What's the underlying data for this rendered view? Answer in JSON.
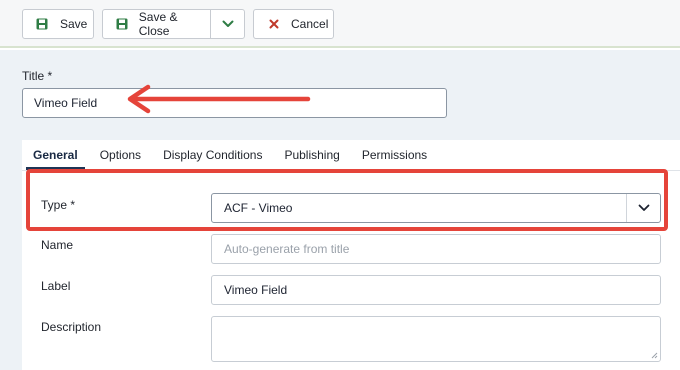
{
  "toolbar": {
    "save_label": "Save",
    "save_close_label": "Save & Close",
    "cancel_label": "Cancel"
  },
  "title_field": {
    "label": "Title *",
    "value": "Vimeo Field"
  },
  "tabs": [
    {
      "label": "General",
      "active": true
    },
    {
      "label": "Options",
      "active": false
    },
    {
      "label": "Display Conditions",
      "active": false
    },
    {
      "label": "Publishing",
      "active": false
    },
    {
      "label": "Permissions",
      "active": false
    }
  ],
  "form": {
    "type": {
      "label": "Type *",
      "value": "ACF - Vimeo"
    },
    "name": {
      "label": "Name",
      "placeholder": "Auto-generate from title"
    },
    "label": {
      "label": "Label",
      "value": "Vimeo Field"
    },
    "description": {
      "label": "Description",
      "value": ""
    }
  },
  "colors": {
    "annotation": "#e5443a",
    "save_icon": "#2f7d45",
    "cancel_icon": "#c0392b",
    "tab_active": "#1e3455"
  },
  "icons": {
    "save": "floppy-disk-icon",
    "save_close": "floppy-disk-icon",
    "dropdown": "chevron-down-icon",
    "cancel": "close-x-icon"
  }
}
